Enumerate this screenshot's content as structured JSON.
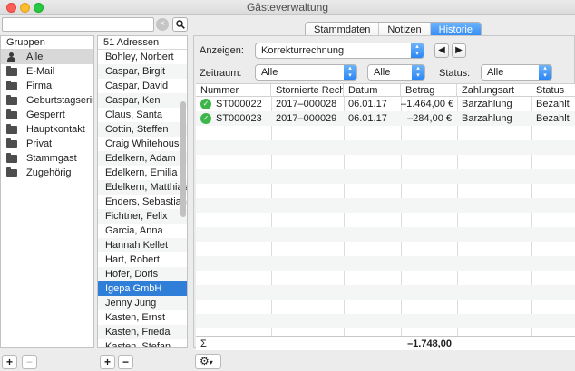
{
  "window": {
    "title": "Gästeverwaltung"
  },
  "search": {
    "value": "",
    "clear_glyph": "⊗",
    "search_glyph": "🔍"
  },
  "tabs": [
    {
      "label": "Stammdaten",
      "active": false
    },
    {
      "label": "Notizen",
      "active": false
    },
    {
      "label": "Historie",
      "active": true
    }
  ],
  "groups": {
    "header": "Gruppen",
    "items": [
      {
        "label": "Alle",
        "icon": "users-icon",
        "selected": true
      },
      {
        "label": "E-Mail",
        "icon": "folder-icon"
      },
      {
        "label": "Firma",
        "icon": "folder-icon"
      },
      {
        "label": "Geburtstagserin…",
        "icon": "folder-icon"
      },
      {
        "label": "Gesperrt",
        "icon": "folder-icon"
      },
      {
        "label": "Hauptkontakt",
        "icon": "folder-icon"
      },
      {
        "label": "Privat",
        "icon": "folder-icon"
      },
      {
        "label": "Stammgast",
        "icon": "folder-icon"
      },
      {
        "label": "Zugehörig",
        "icon": "folder-icon"
      }
    ]
  },
  "addresses": {
    "header": "51 Adressen",
    "items": [
      "Bohley, Norbert",
      "Caspar, Birgit",
      "Caspar, David",
      "Caspar, Ken",
      "Claus, Santa",
      "Cottin, Steffen",
      "Craig Whitehouse",
      "Edelkern, Adam",
      "Edelkern, Emilia …",
      "Edelkern, Matthias",
      "Enders, Sebastian",
      "Fichtner, Felix",
      "Garcia, Anna",
      "Hannah Kellet",
      "Hart, Robert",
      "Hofer, Doris",
      "Igepa GmbH",
      "Jenny Jung",
      "Kasten, Ernst",
      "Kasten, Frieda",
      "Kasten, Stefan"
    ],
    "selected_index": 16
  },
  "filters": {
    "anzeigen_label": "Anzeigen:",
    "anzeigen_value": "Korrekturrechnung",
    "zeitraum_label": "Zeitraum:",
    "zeitraum_value": "Alle",
    "zeitraum2_value": "Alle",
    "status_label": "Status:",
    "status_value": "Alle",
    "prev_glyph": "◀",
    "next_glyph": "▶"
  },
  "table": {
    "columns": [
      "Nummer",
      "Stornierte Rech…",
      "Datum",
      "Betrag",
      "Zahlungsart",
      "Status"
    ],
    "rows": [
      {
        "nummer": "ST000022",
        "storniert": "2017–000028",
        "datum": "06.01.17",
        "betrag": "–1.464,00 €",
        "zahlungsart": "Barzahlung",
        "status": "Bezahlt"
      },
      {
        "nummer": "ST000023",
        "storniert": "2017–000029",
        "datum": "06.01.17",
        "betrag": "–284,00 €",
        "zahlungsart": "Barzahlung",
        "status": "Bezahlt"
      }
    ],
    "sum_symbol": "Σ",
    "sum_value": "–1.748,00"
  },
  "bottom": {
    "add_glyph": "+",
    "remove_glyph": "−",
    "gear_glyph": "⚙",
    "gear_caret": "▾"
  }
}
